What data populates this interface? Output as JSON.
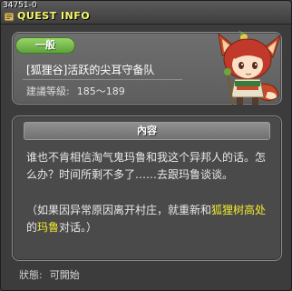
{
  "window": {
    "quest_id": "34751-0",
    "title": "QUEST INFO"
  },
  "header": {
    "category": "一般",
    "quest_name": "[狐狸谷]活跃的尖耳守备队",
    "level_label": "建議等級:",
    "level_value": "185～189"
  },
  "content": {
    "section_title": "內容",
    "line1": "谁也不肯相信淘气鬼玛鲁和我这个异邦人的话。怎么办？时间所剩不多了……去跟玛鲁谈谈。",
    "note_prefix": "（如果因异常原因离开村庄，就重新和",
    "note_highlight1": "狐狸树高处",
    "note_mid": "的",
    "note_highlight2": "玛鲁",
    "note_suffix": "对话。）"
  },
  "status": {
    "label": "狀態:",
    "value": "可開始"
  },
  "colors": {
    "highlight": "#f2ea2e",
    "title": "#f5f56a",
    "category": "#5ea23a"
  }
}
